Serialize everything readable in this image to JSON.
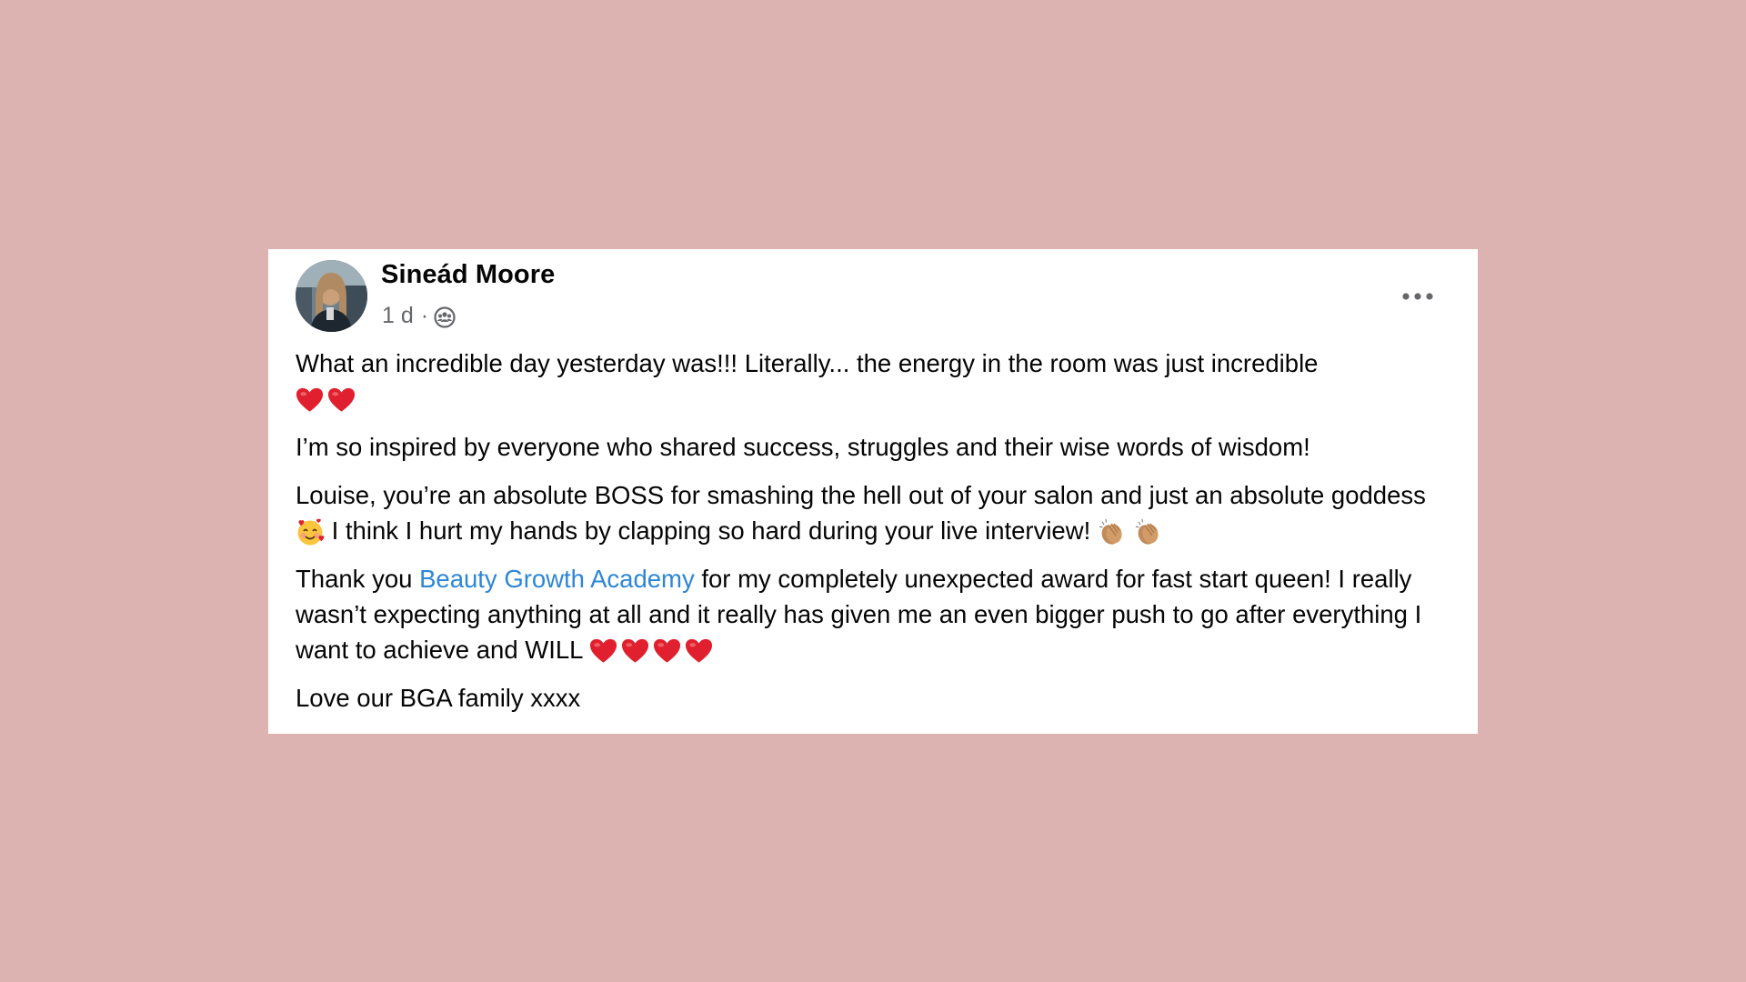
{
  "post": {
    "author": {
      "name": "Sineád Moore",
      "avatar_icon": "profile-photo"
    },
    "meta": {
      "time": "1 d",
      "separator": "·",
      "audience_icon": "group-audience-icon"
    },
    "menu_icon": "more-options-icon",
    "paragraphs": {
      "p1": {
        "text": "What an incredible day yesterday was!!! Literally... the energy in the room was just incredible",
        "emoji": [
          "red-heart",
          "red-heart"
        ]
      },
      "p2": {
        "text": "I’m so inspired by everyone who shared success, struggles and their wise words of wisdom!"
      },
      "p3": {
        "text_a": "Louise, you’re an absolute BOSS for smashing the hell out of your salon and just an absolute goddess",
        "emoji_a": "smiling-face-with-hearts",
        "text_b": " I think I hurt my hands by clapping so hard during your live interview!",
        "emoji_b": [
          "clapping-hands",
          "clapping-hands"
        ]
      },
      "p4": {
        "text_a": "Thank you ",
        "link": "Beauty Growth Academy",
        "text_b": " for my completely unexpected award for fast start queen! I really wasn’t expecting anything at all and it really has given me an even bigger push to go after everything I want to achieve and WILL",
        "emoji": [
          "red-heart",
          "red-heart",
          "red-heart",
          "red-heart"
        ]
      },
      "p5": {
        "text": "Love our BGA family xxxx"
      }
    }
  },
  "colors": {
    "background": "#ddb3b2",
    "card": "#ffffff",
    "text": "#050505",
    "secondary_text": "#65676b",
    "link": "#2d86d6",
    "heart": "#e0202e"
  }
}
